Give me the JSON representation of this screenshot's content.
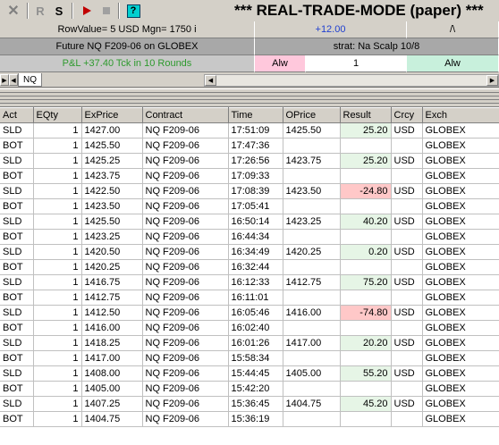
{
  "toolbar": {
    "close_glyph": "✕",
    "r_label": "R",
    "s_label": "S",
    "help_label": "?",
    "mode_title": "*** REAL-TRADE-MODE (paper) ***"
  },
  "info": {
    "row_value": "RowValue= 5 USD Mgn= 1750 i",
    "price_change": "+12.00",
    "caret": "/\\",
    "contract_desc": "Future NQ  F209-06 on GLOBEX",
    "strategy": "strat: Na Scalp 10/8",
    "pnl": "P&L +37.40 Tck in 10 Rounds",
    "alw_left": "Alw",
    "qty_input": "1",
    "alw_right": "Alw"
  },
  "colors": {
    "price_change": "#1f3fd0",
    "pnl_text": "#2e9a2e",
    "alw_left_bg": "#ffc8dc",
    "alw_right_bg": "#c8f0dc",
    "result_pos_bg": "#e6f5e6",
    "result_neg_bg": "#ffc8c8"
  },
  "tabs": [
    {
      "label": "NQ"
    }
  ],
  "table": {
    "columns": [
      "Act",
      "EQty",
      "ExPrice",
      "Contract",
      "Time",
      "OPrice",
      "Result",
      "Crcy",
      "Exch"
    ],
    "rows": [
      {
        "act": "SLD",
        "eqty": "1",
        "exprice": "1427.00",
        "contract": "NQ  F209-06",
        "time": "17:51:09",
        "oprice": "1425.50",
        "result": "25.20",
        "sign": "pos",
        "crcy": "USD",
        "exch": "GLOBEX"
      },
      {
        "act": "BOT",
        "eqty": "1",
        "exprice": "1425.50",
        "contract": "NQ  F209-06",
        "time": "17:47:36",
        "oprice": "",
        "result": "",
        "sign": "",
        "crcy": "",
        "exch": "GLOBEX"
      },
      {
        "act": "SLD",
        "eqty": "1",
        "exprice": "1425.25",
        "contract": "NQ  F209-06",
        "time": "17:26:56",
        "oprice": "1423.75",
        "result": "25.20",
        "sign": "pos",
        "crcy": "USD",
        "exch": "GLOBEX"
      },
      {
        "act": "BOT",
        "eqty": "1",
        "exprice": "1423.75",
        "contract": "NQ  F209-06",
        "time": "17:09:33",
        "oprice": "",
        "result": "",
        "sign": "",
        "crcy": "",
        "exch": "GLOBEX"
      },
      {
        "act": "SLD",
        "eqty": "1",
        "exprice": "1422.50",
        "contract": "NQ  F209-06",
        "time": "17:08:39",
        "oprice": "1423.50",
        "result": "-24.80",
        "sign": "neg",
        "crcy": "USD",
        "exch": "GLOBEX"
      },
      {
        "act": "BOT",
        "eqty": "1",
        "exprice": "1423.50",
        "contract": "NQ  F209-06",
        "time": "17:05:41",
        "oprice": "",
        "result": "",
        "sign": "",
        "crcy": "",
        "exch": "GLOBEX"
      },
      {
        "act": "SLD",
        "eqty": "1",
        "exprice": "1425.50",
        "contract": "NQ  F209-06",
        "time": "16:50:14",
        "oprice": "1423.25",
        "result": "40.20",
        "sign": "pos",
        "crcy": "USD",
        "exch": "GLOBEX"
      },
      {
        "act": "BOT",
        "eqty": "1",
        "exprice": "1423.25",
        "contract": "NQ  F209-06",
        "time": "16:44:34",
        "oprice": "",
        "result": "",
        "sign": "",
        "crcy": "",
        "exch": "GLOBEX"
      },
      {
        "act": "SLD",
        "eqty": "1",
        "exprice": "1420.50",
        "contract": "NQ  F209-06",
        "time": "16:34:49",
        "oprice": "1420.25",
        "result": "0.20",
        "sign": "pos",
        "crcy": "USD",
        "exch": "GLOBEX"
      },
      {
        "act": "BOT",
        "eqty": "1",
        "exprice": "1420.25",
        "contract": "NQ  F209-06",
        "time": "16:32:44",
        "oprice": "",
        "result": "",
        "sign": "",
        "crcy": "",
        "exch": "GLOBEX"
      },
      {
        "act": "SLD",
        "eqty": "1",
        "exprice": "1416.75",
        "contract": "NQ  F209-06",
        "time": "16:12:33",
        "oprice": "1412.75",
        "result": "75.20",
        "sign": "pos",
        "crcy": "USD",
        "exch": "GLOBEX"
      },
      {
        "act": "BOT",
        "eqty": "1",
        "exprice": "1412.75",
        "contract": "NQ  F209-06",
        "time": "16:11:01",
        "oprice": "",
        "result": "",
        "sign": "",
        "crcy": "",
        "exch": "GLOBEX"
      },
      {
        "act": "SLD",
        "eqty": "1",
        "exprice": "1412.50",
        "contract": "NQ  F209-06",
        "time": "16:05:46",
        "oprice": "1416.00",
        "result": "-74.80",
        "sign": "neg",
        "crcy": "USD",
        "exch": "GLOBEX"
      },
      {
        "act": "BOT",
        "eqty": "1",
        "exprice": "1416.00",
        "contract": "NQ  F209-06",
        "time": "16:02:40",
        "oprice": "",
        "result": "",
        "sign": "",
        "crcy": "",
        "exch": "GLOBEX"
      },
      {
        "act": "SLD",
        "eqty": "1",
        "exprice": "1418.25",
        "contract": "NQ  F209-06",
        "time": "16:01:26",
        "oprice": "1417.00",
        "result": "20.20",
        "sign": "pos",
        "crcy": "USD",
        "exch": "GLOBEX"
      },
      {
        "act": "BOT",
        "eqty": "1",
        "exprice": "1417.00",
        "contract": "NQ  F209-06",
        "time": "15:58:34",
        "oprice": "",
        "result": "",
        "sign": "",
        "crcy": "",
        "exch": "GLOBEX"
      },
      {
        "act": "SLD",
        "eqty": "1",
        "exprice": "1408.00",
        "contract": "NQ  F209-06",
        "time": "15:44:45",
        "oprice": "1405.00",
        "result": "55.20",
        "sign": "pos",
        "crcy": "USD",
        "exch": "GLOBEX"
      },
      {
        "act": "BOT",
        "eqty": "1",
        "exprice": "1405.00",
        "contract": "NQ  F209-06",
        "time": "15:42:20",
        "oprice": "",
        "result": "",
        "sign": "",
        "crcy": "",
        "exch": "GLOBEX"
      },
      {
        "act": "SLD",
        "eqty": "1",
        "exprice": "1407.25",
        "contract": "NQ  F209-06",
        "time": "15:36:45",
        "oprice": "1404.75",
        "result": "45.20",
        "sign": "pos",
        "crcy": "USD",
        "exch": "GLOBEX"
      },
      {
        "act": "BOT",
        "eqty": "1",
        "exprice": "1404.75",
        "contract": "NQ  F209-06",
        "time": "15:36:19",
        "oprice": "",
        "result": "",
        "sign": "",
        "crcy": "",
        "exch": "GLOBEX"
      }
    ]
  }
}
